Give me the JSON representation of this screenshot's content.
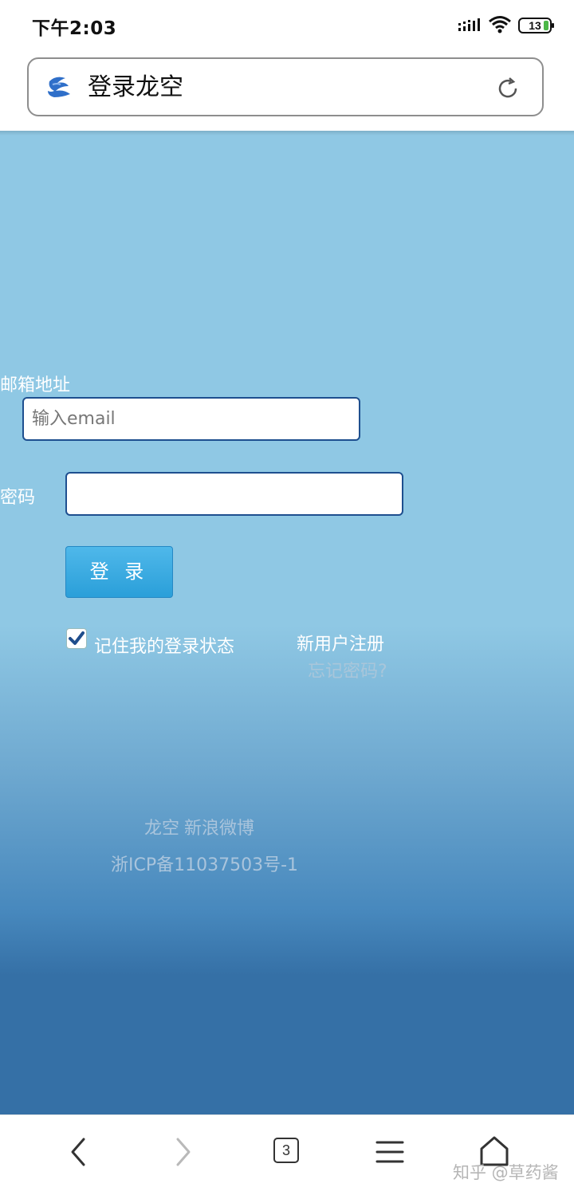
{
  "status_bar": {
    "time": "下午2:03",
    "battery": "13",
    "icons": [
      "signal-icon",
      "wifi-icon",
      "battery-icon"
    ]
  },
  "url_bar": {
    "title": "登录龙空",
    "icons": [
      "site-logo-icon",
      "reload-icon"
    ]
  },
  "form": {
    "email_label": "邮箱地址",
    "email_placeholder": "输入email",
    "email_value": "",
    "password_label": "密码",
    "password_value": "",
    "login_button": "登 录",
    "remember_label": "记住我的登录状态",
    "remember_checked": true,
    "register_link": "新用户注册",
    "forgot_link": "忘记密码?"
  },
  "footer": {
    "links": [
      "龙空",
      "新浪微博"
    ],
    "icp": "浙ICP备11037503号-1"
  },
  "bottom_nav": {
    "tabs_count": "3",
    "icons": [
      "back-icon",
      "forward-icon",
      "tabs-icon",
      "menu-icon",
      "home-icon"
    ]
  },
  "watermark": "知乎 @草药酱",
  "colors": {
    "page_top": "#8fc8e4",
    "page_bottom": "#3570a6",
    "button": "#2a9fd9",
    "input_border": "#1e4f8f"
  }
}
